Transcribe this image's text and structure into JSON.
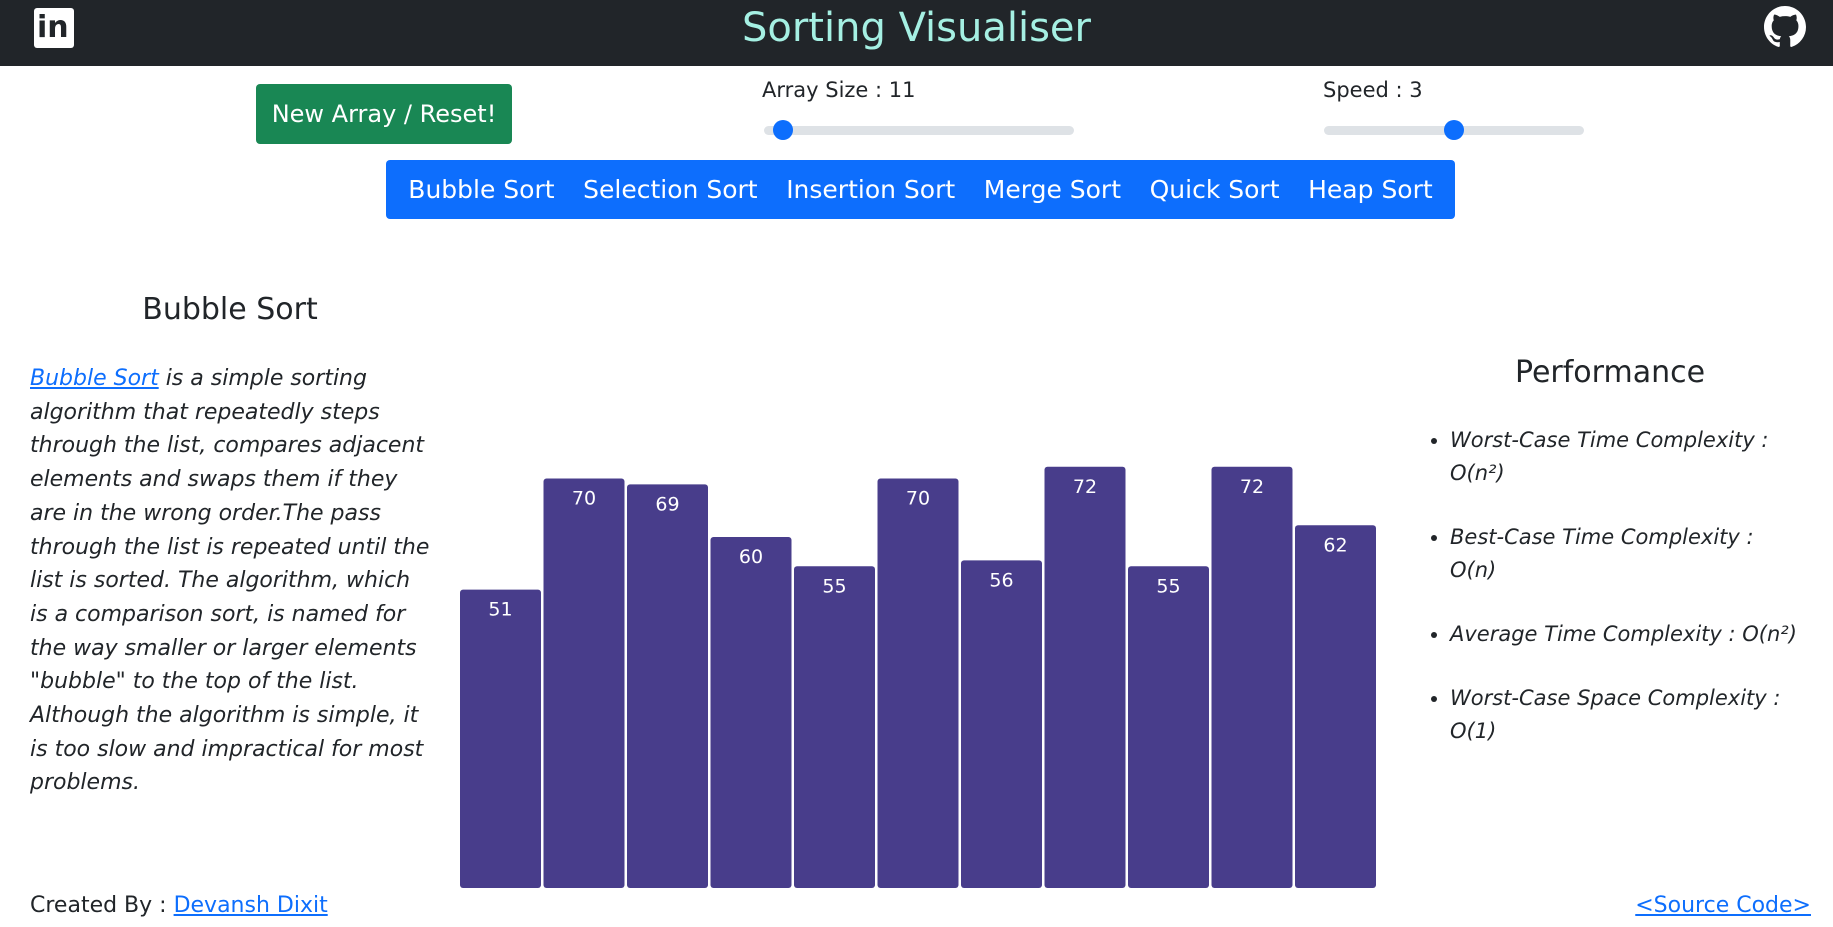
{
  "header": {
    "title": "Sorting Visualiser",
    "linkedin_icon": "linkedin-icon",
    "linkedin_text": "in",
    "github_icon": "github-icon"
  },
  "controls": {
    "reset_label": "New Array / Reset!",
    "array_size_label": "Array Size : 11",
    "array_size": {
      "value": 11,
      "fraction": 0.03
    },
    "speed_label": "Speed : 3",
    "speed": {
      "value": 3,
      "fraction": 0.5
    }
  },
  "sort_tabs": [
    "Bubble Sort",
    "Selection Sort",
    "Insertion Sort",
    "Merge Sort",
    "Quick Sort",
    "Heap Sort"
  ],
  "algorithm": {
    "title": "Bubble Sort",
    "link_text": "Bubble Sort",
    "description": " is a simple sorting algorithm that repeatedly steps through the list, compares adjacent elements and swaps them if they are in the wrong order.The pass through the list is repeated until the list is sorted. The algorithm, which is a comparison sort, is named for the way smaller or larger elements \"bubble\" to the top of the list. Although the algorithm is simple, it is too slow and impractical for most problems."
  },
  "performance": {
    "title": "Performance",
    "items": [
      "Worst-Case Time Complexity : O(n²)",
      "Best-Case Time Complexity : O(n)",
      "Average Time Complexity : O(n²)",
      "Worst-Case Space Complexity : O(1)"
    ]
  },
  "chart_data": {
    "type": "bar",
    "values": [
      51,
      70,
      69,
      60,
      55,
      70,
      56,
      72,
      55,
      72,
      62
    ],
    "bar_color": "#483d8b",
    "label_color": "#ffffff"
  },
  "footer": {
    "created_by_label": "Created By : ",
    "author": "Devansh Dixit",
    "source_code": "<Source Code>"
  },
  "colors": {
    "navbar": "#212529",
    "title": "#a5f0e3",
    "reset_button": "#198754",
    "primary": "#0d6efd"
  }
}
